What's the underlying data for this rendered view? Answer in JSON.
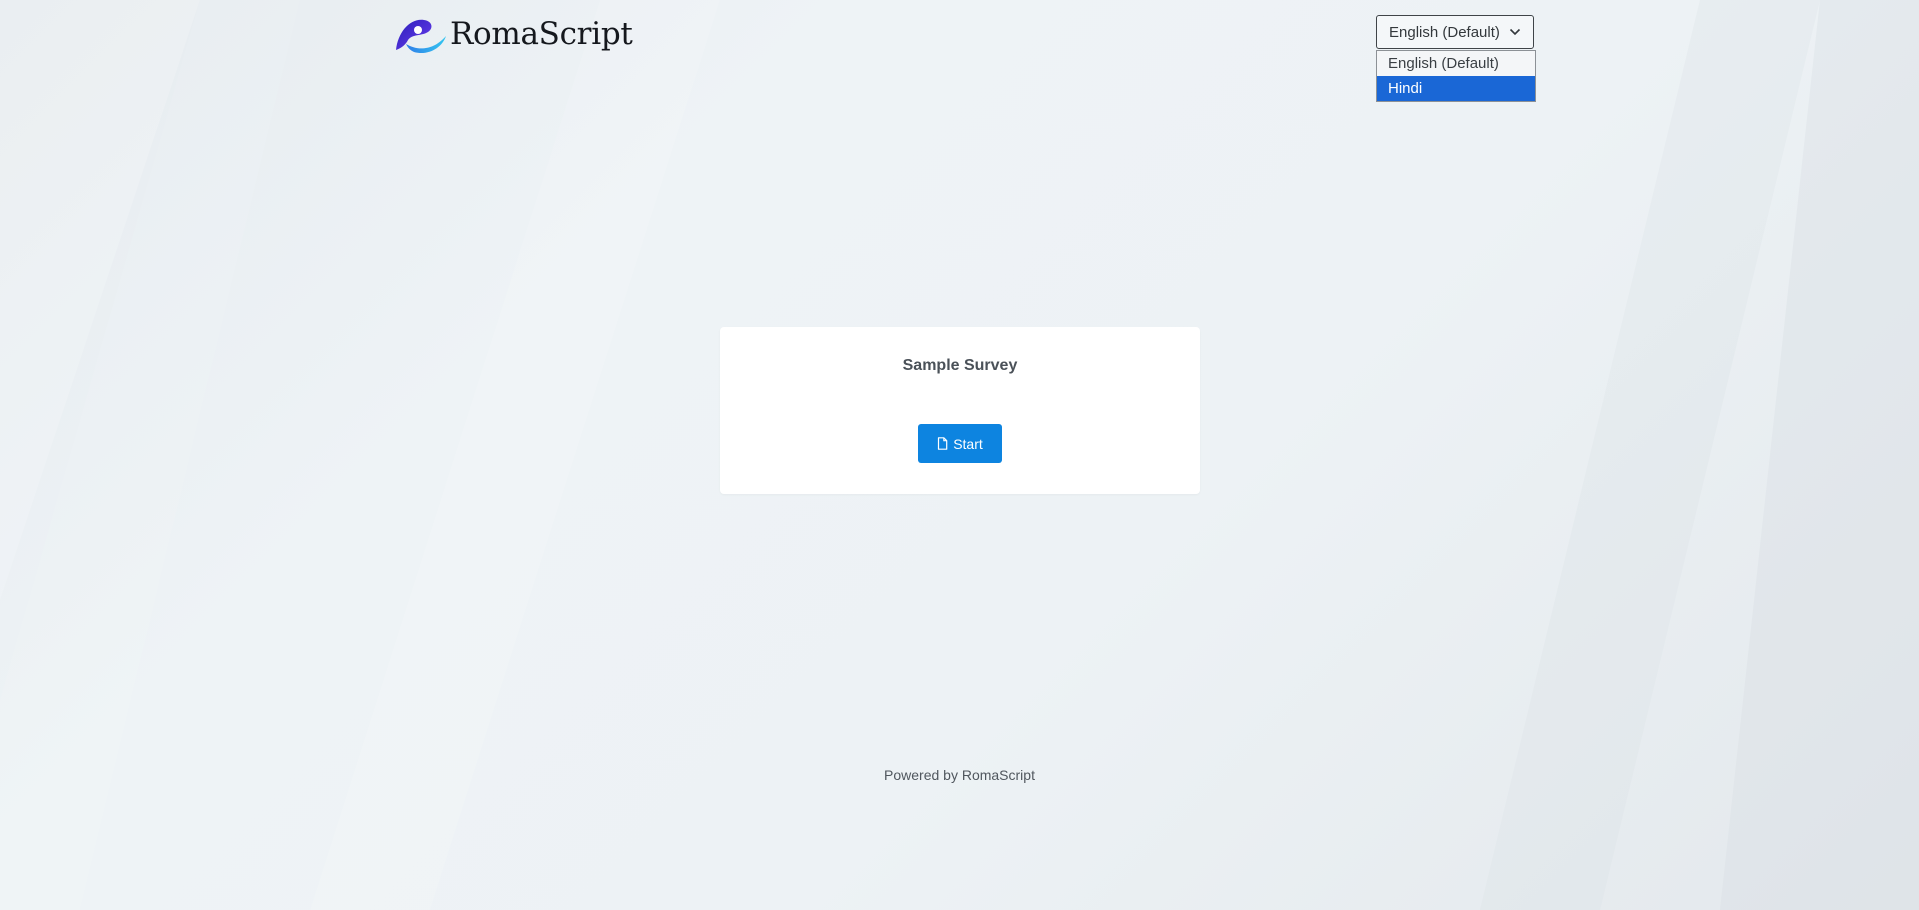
{
  "brand": {
    "name": "RomaScript",
    "logo_icon": "swoosh-logo-icon"
  },
  "language": {
    "selected": "English (Default)",
    "options": [
      "English (Default)",
      "Hindi"
    ],
    "highlighted_index": 1,
    "chevron_icon": "chevron-down-icon"
  },
  "survey": {
    "title": "Sample Survey",
    "start_label": "Start",
    "start_icon": "document-icon"
  },
  "footer": {
    "text": "Powered by RomaScript"
  },
  "colors": {
    "accent": "#0d84e0",
    "dropdown_highlight": "#1a67d6",
    "background": "#edf2f5",
    "card": "#ffffff"
  }
}
